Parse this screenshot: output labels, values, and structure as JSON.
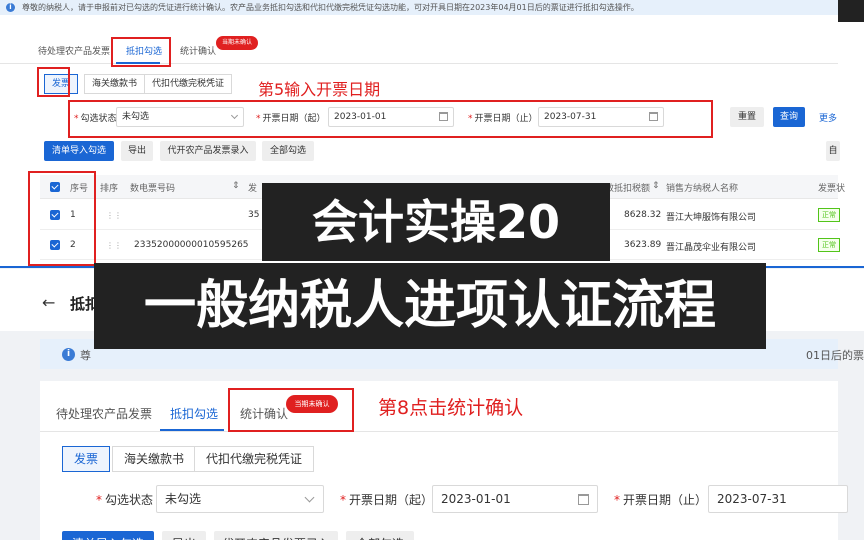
{
  "top": {
    "notice": "尊敬的纳税人，请于申报前对已勾选的凭证进行统计确认。农产品业务抵扣勾选和代扣代缴完税凭证勾选功能，可对开具日期在2023年04月01日后的票证进行抵扣勾选操作。",
    "tabs": [
      "待处理农产品发票",
      "抵扣勾选",
      "统计确认"
    ],
    "badge": "当期未确认",
    "segments": [
      "发票",
      "海关缴款书",
      "代扣代缴完税凭证"
    ],
    "annotation": "第5输入开票日期",
    "filters": {
      "status_label": "勾选状态",
      "status_value": "未勾选",
      "start_label": "开票日期（起）",
      "start_value": "2023-01-01",
      "end_label": "开票日期（止）",
      "end_value": "2023-07-31"
    },
    "reset": "重置",
    "query": "查询",
    "more": "更多",
    "actions": [
      "清单导入勾选",
      "导出",
      "代开农产品发票录入",
      "全部勾选"
    ],
    "right_cut": "自",
    "columns": {
      "no": "序号",
      "sort": "排序",
      "invoice_no": "数电票号码",
      "code_cut": "发",
      "tax": "有效抵扣税额",
      "seller": "销售方纳税人名称",
      "status": "发票状"
    },
    "rows": [
      {
        "no": "1",
        "invoice_no": "",
        "code": "35",
        "tax": "8628.32",
        "seller": "晋江大坤服饰有限公司",
        "status": "正常"
      },
      {
        "no": "2",
        "invoice_no": "23352000000010595265",
        "code": "",
        "tax": "3623.89",
        "seller": "晋江晶茂伞业有限公司",
        "status": "正常"
      }
    ]
  },
  "titles": {
    "line1": "会计实操20",
    "line2": "一般纳税人进项认证流程"
  },
  "bottom": {
    "back_title": "抵扣",
    "notice_prefix": "尊",
    "notice_tail": "01日后的票证",
    "tabs": [
      "待处理农产品发票",
      "抵扣勾选",
      "统计确认"
    ],
    "badge": "当期未确认",
    "annotation": "第8点击统计确认",
    "segments": [
      "发票",
      "海关缴款书",
      "代扣代缴完税凭证"
    ],
    "filters": {
      "status_label": "勾选状态",
      "status_value": "未勾选",
      "start_label": "开票日期（起）",
      "start_value": "2023-01-01",
      "end_label": "开票日期（止）",
      "end_value": "2023-07-31"
    },
    "actions": [
      "清单导入勾选",
      "导出",
      "代开农产品发票录入",
      "全部勾选"
    ]
  },
  "colors": {
    "accent": "#1a66d4",
    "annotation_red": "#e02020",
    "title_bg": "#222222"
  }
}
